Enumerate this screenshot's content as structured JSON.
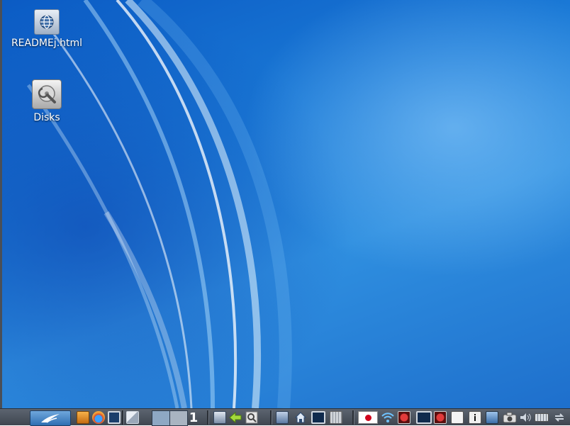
{
  "desktop": {
    "icons": [
      {
        "label": "READMEj.html",
        "icon": "globe-icon"
      },
      {
        "label": "Disks",
        "icon": "disk-utility-icon"
      }
    ]
  },
  "taskbar": {
    "workspace_number": "1",
    "colors": {
      "bar": "#4b525c",
      "accent": "#1e7fd6"
    }
  }
}
